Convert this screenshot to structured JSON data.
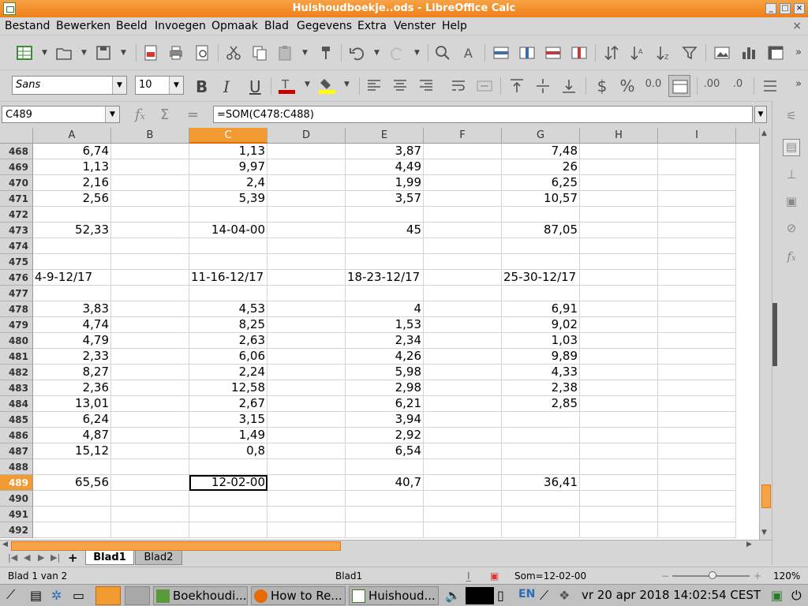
{
  "window": {
    "title": "Huishoudboekje..ods - LibreOffice Calc"
  },
  "menu": [
    "Bestand",
    "Bewerken",
    "Beeld",
    "Invoegen",
    "Opmaak",
    "Blad",
    "Gegevens",
    "Extra",
    "Venster",
    "Help"
  ],
  "format": {
    "font_name": "Sans",
    "font_size": "10"
  },
  "formula_bar": {
    "name_box": "C489",
    "formula": "=SOM(C478:C488)"
  },
  "columns": [
    "A",
    "B",
    "C",
    "D",
    "E",
    "F",
    "G",
    "H",
    "I"
  ],
  "selected_column": "C",
  "selected_row": "489",
  "rows": [
    {
      "n": "468",
      "A": "6,74",
      "C": "1,13",
      "E": "3,87",
      "G": "7,48"
    },
    {
      "n": "469",
      "A": "1,13",
      "C": "9,97",
      "E": "4,49",
      "G": "26"
    },
    {
      "n": "470",
      "A": "2,16",
      "C": "2,4",
      "E": "1,99",
      "G": "6,25"
    },
    {
      "n": "471",
      "A": "2,56",
      "C": "5,39",
      "E": "3,57",
      "G": "10,57"
    },
    {
      "n": "472"
    },
    {
      "n": "473",
      "A": "52,33",
      "C": "14-04-00",
      "E": "45",
      "G": "87,05"
    },
    {
      "n": "474"
    },
    {
      "n": "475"
    },
    {
      "n": "476",
      "A": "4-9-12/17",
      "C": "11-16-12/17",
      "E": "18-23-12/17",
      "G": "25-30-12/17"
    },
    {
      "n": "477"
    },
    {
      "n": "478",
      "A": "3,83",
      "C": "4,53",
      "E": "4",
      "G": "6,91"
    },
    {
      "n": "479",
      "A": "4,74",
      "C": "8,25",
      "E": "1,53",
      "G": "9,02"
    },
    {
      "n": "480",
      "A": "4,79",
      "C": "2,63",
      "E": "2,34",
      "G": "1,03"
    },
    {
      "n": "481",
      "A": "2,33",
      "C": "6,06",
      "E": "4,26",
      "G": "9,89"
    },
    {
      "n": "482",
      "A": "8,27",
      "C": "2,24",
      "E": "5,98",
      "G": "4,33"
    },
    {
      "n": "483",
      "A": "2,36",
      "C": "12,58",
      "E": "2,98",
      "G": "2,38"
    },
    {
      "n": "484",
      "A": "13,01",
      "C": "2,67",
      "E": "6,21",
      "G": "2,85"
    },
    {
      "n": "485",
      "A": "6,24",
      "C": "3,15",
      "E": "3,94"
    },
    {
      "n": "486",
      "A": "4,87",
      "C": "1,49",
      "E": "2,92"
    },
    {
      "n": "487",
      "A": "15,12",
      "C": "0,8",
      "E": "6,54"
    },
    {
      "n": "488"
    },
    {
      "n": "489",
      "A": "65,56",
      "C": "12-02-00",
      "E": "40,7",
      "G": "36,41"
    },
    {
      "n": "490"
    },
    {
      "n": "491"
    },
    {
      "n": "492"
    }
  ],
  "sheet_tabs": [
    "Blad1",
    "Blad2"
  ],
  "active_tab": "Blad1",
  "status": {
    "sheet_of": "Blad 1 van 2",
    "page_style": "Blad1",
    "sum": "Som=12-02-00",
    "zoom": "120%"
  },
  "taskbar": {
    "tasks": [
      "Boekhoudi...",
      "How to Re...",
      "Huishoud..."
    ],
    "lang": "EN",
    "clock": "vr 20 apr 2018 14:02:54 CEST"
  },
  "colors": {
    "accent": "#f29b33",
    "title": "#ef7f16"
  }
}
